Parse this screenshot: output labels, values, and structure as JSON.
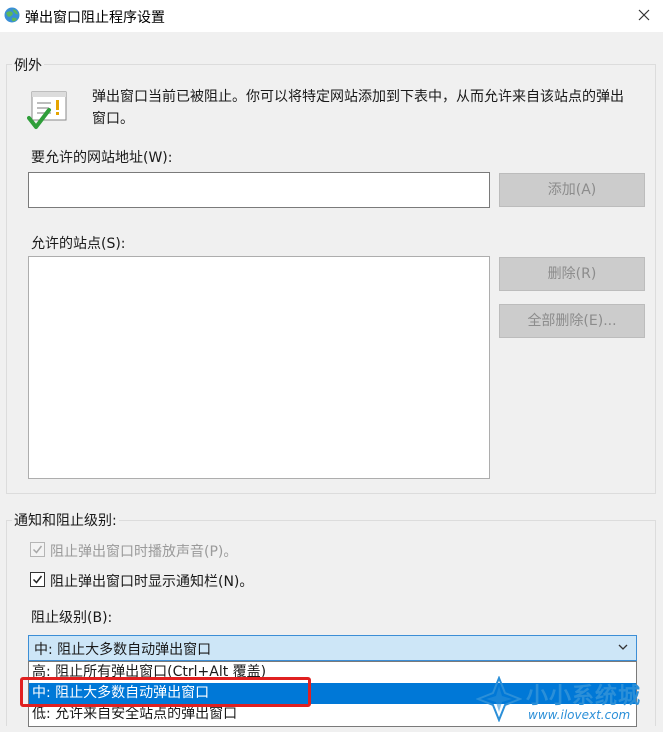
{
  "window": {
    "title": "弹出窗口阻止程序设置"
  },
  "exceptions": {
    "group_label": "例外",
    "info_text": "弹出窗口当前已被阻止。你可以将特定网站添加到下表中，从而允许来自该站点的弹出窗口。",
    "address_label": "要允许的网站地址(W):",
    "address_value": "",
    "add_button": "添加(A)",
    "allowed_label": "允许的站点(S):",
    "allowed_sites": [],
    "remove_button": "删除(R)",
    "remove_all_button": "全部删除(E)..."
  },
  "notifications": {
    "group_label": "通知和阻止级别:",
    "play_sound": {
      "label": "阻止弹出窗口时播放声音(P)。",
      "checked": true,
      "disabled": true
    },
    "show_bar": {
      "label": "阻止弹出窗口时显示通知栏(N)。",
      "checked": true,
      "disabled": false
    },
    "level_label": "阻止级别(B):",
    "level_value": "中: 阻止大多数自动弹出窗口",
    "options": [
      "高: 阻止所有弹出窗口(Ctrl+Alt 覆盖)",
      "中: 阻止大多数自动弹出窗口",
      "低: 允许来自安全站点的弹出窗口"
    ],
    "selected_index": 1
  },
  "watermark": {
    "title": "小小系统城",
    "url": "www.ilovext.com"
  },
  "colors": {
    "accent": "#0078d7",
    "highlight": "#e02020",
    "watermark": "#2b8fd8"
  }
}
